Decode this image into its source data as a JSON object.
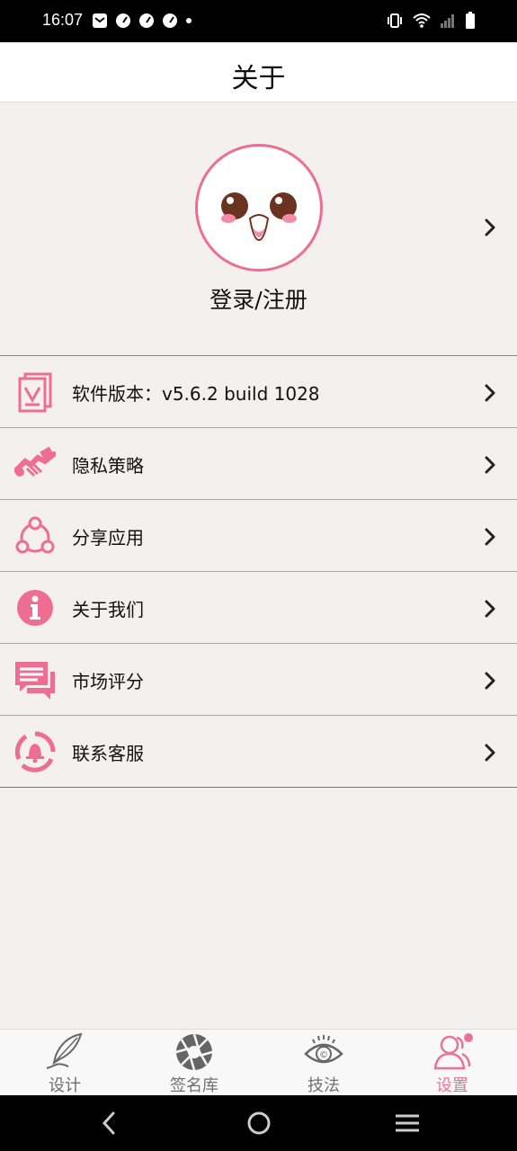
{
  "status_bar": {
    "time": "16:07"
  },
  "header": {
    "title": "关于"
  },
  "profile": {
    "login_label": "登录/注册"
  },
  "menu": {
    "items": [
      {
        "label": "软件版本：v5.6.2  build 1028",
        "icon": "version-doc-icon"
      },
      {
        "label": "隐私策略",
        "icon": "handshake-icon"
      },
      {
        "label": "分享应用",
        "icon": "share-icon"
      },
      {
        "label": "关于我们",
        "icon": "info-icon"
      },
      {
        "label": "市场评分",
        "icon": "chat-bubble-icon"
      },
      {
        "label": "联系客服",
        "icon": "bell-support-icon"
      }
    ]
  },
  "bottom_nav": {
    "tabs": [
      {
        "label": "设计",
        "icon": "quill-pen-icon",
        "active": false
      },
      {
        "label": "签名库",
        "icon": "aperture-icon",
        "active": false
      },
      {
        "label": "技法",
        "icon": "eye-icon",
        "active": false
      },
      {
        "label": "设置",
        "icon": "users-icon",
        "active": true
      }
    ]
  },
  "colors": {
    "accent": "#ee6d93",
    "background": "#f4f0ed",
    "inactive_tab": "#6f6f6f"
  }
}
